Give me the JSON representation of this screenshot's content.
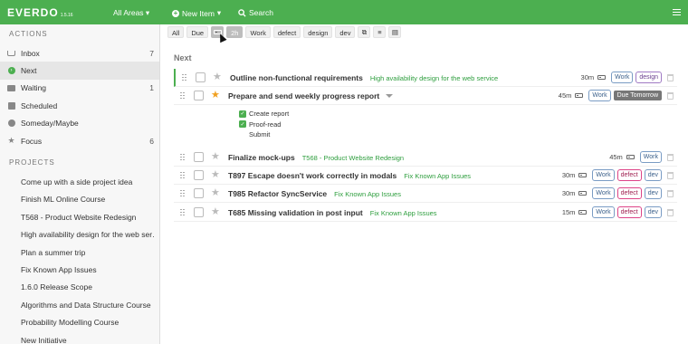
{
  "app": {
    "logo": "EVERDO",
    "version": "1.5.16"
  },
  "topbar": {
    "areas_label": "All Areas",
    "new_item_label": "New Item",
    "search_label": "Search"
  },
  "sidebar": {
    "actions_header": "ACTIONS",
    "actions": [
      {
        "label": "Inbox",
        "count": "7",
        "icon": "inbox-icon"
      },
      {
        "label": "Next",
        "count": "",
        "icon": "next-icon",
        "active": true
      },
      {
        "label": "Waiting",
        "count": "1",
        "icon": "waiting-icon"
      },
      {
        "label": "Scheduled",
        "count": "",
        "icon": "calendar-icon"
      },
      {
        "label": "Someday/Maybe",
        "count": "",
        "icon": "someday-icon"
      },
      {
        "label": "Focus",
        "count": "6",
        "icon": "star-icon"
      }
    ],
    "projects_header": "PROJECTS",
    "projects": [
      "Come up with a side project idea",
      "Finish ML Online Course",
      "T568 - Product Website Redesign",
      "High availability design for the web ser…",
      "Plan a summer trip",
      "Fix Known App Issues",
      "1.6.0 Release Scope",
      "Algorithms and Data Structure Course",
      "Probability Modelling Course",
      "New Initiative"
    ]
  },
  "filters": {
    "all": "All",
    "due": "Due",
    "time": "2h",
    "tags": [
      "Work",
      "defect",
      "design",
      "dev"
    ]
  },
  "main": {
    "heading": "Next",
    "tasks": [
      {
        "title": "Outline non-functional requirements",
        "project": "High availability design for the web service",
        "duration": "30m",
        "tags": [
          "Work",
          "design"
        ],
        "starred": false,
        "due": ""
      },
      {
        "title": "Prepare and send weekly progress report",
        "project": "",
        "duration": "45m",
        "tags": [
          "Work"
        ],
        "starred": true,
        "due": "Due Tomorrow",
        "checklist": [
          {
            "label": "Create report",
            "done": true
          },
          {
            "label": "Proof-read",
            "done": true
          },
          {
            "label": "Submit",
            "done": false
          }
        ]
      },
      {
        "title": "Finalize mock-ups",
        "project": "T568 - Product Website Redesign",
        "duration": "45m",
        "tags": [
          "Work"
        ],
        "starred": false,
        "due": ""
      },
      {
        "title": "T897 Escape doesn't work correctly in modals",
        "project": "Fix Known App Issues",
        "duration": "30m",
        "tags": [
          "Work",
          "defect",
          "dev"
        ],
        "starred": false,
        "due": ""
      },
      {
        "title": "T985 Refactor SyncService",
        "project": "Fix Known App Issues",
        "duration": "30m",
        "tags": [
          "Work",
          "defect",
          "dev"
        ],
        "starred": false,
        "due": ""
      },
      {
        "title": "T685 Missing validation in post input",
        "project": "Fix Known App Issues",
        "duration": "15m",
        "tags": [
          "Work",
          "defect",
          "dev"
        ],
        "starred": false,
        "due": ""
      }
    ]
  }
}
